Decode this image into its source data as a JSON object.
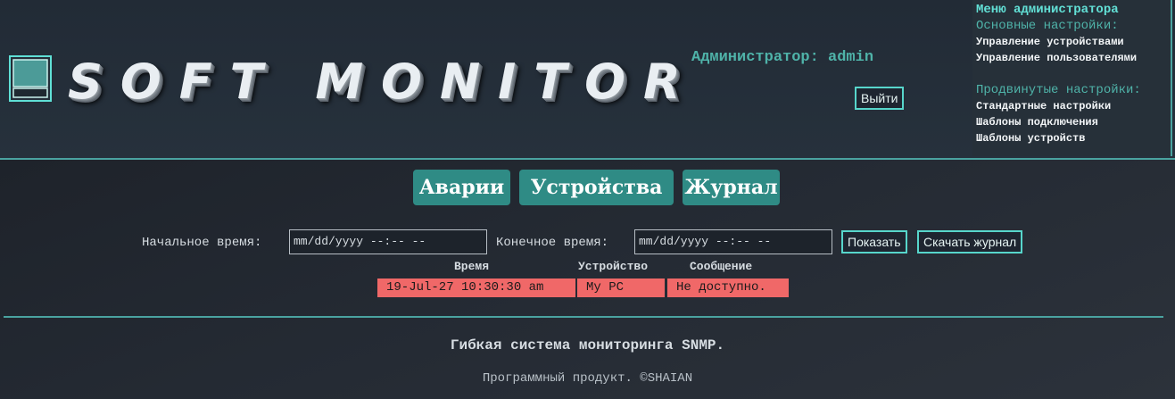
{
  "header": {
    "brand": "SOFT MONITOR",
    "admin_label": "Администратор: admin",
    "logout_label": "Выйти"
  },
  "admin_menu": {
    "title": "Меню администратора",
    "basic_section": "Основные настройки:",
    "basic_items": [
      "Управление устройствами",
      "Управление пользователями"
    ],
    "advanced_section": "Продвинутые настройки:",
    "advanced_items": [
      "Стандартные настройки",
      "Шаблоны подключения",
      "Шаблоны устройств"
    ]
  },
  "tabs": [
    "Аварии",
    "Устройства",
    "Журнал"
  ],
  "filter": {
    "start_label": "Начальное время:",
    "start_placeholder": "mm/dd/yyyy --:-- --",
    "end_label": "Конечное время:",
    "end_placeholder": "mm/dd/yyyy --:-- --",
    "show_label": "Показать",
    "download_label": "Скачать журнал"
  },
  "log_table": {
    "columns": [
      "Время",
      "Устройство",
      "Сообщение"
    ],
    "rows": [
      {
        "time": "19-Jul-27 10:30:30 am",
        "device": "My PC",
        "message": "Не доступно.",
        "status_color": "#f06868"
      }
    ]
  },
  "footer": {
    "tagline": "Гибкая система мониторинга SNMP.",
    "copyright": "Программный продукт. ©SHAIAN"
  },
  "colors": {
    "accent": "#4aa3a0",
    "tab_bg": "#2f8b85",
    "alert_row": "#f06868"
  }
}
